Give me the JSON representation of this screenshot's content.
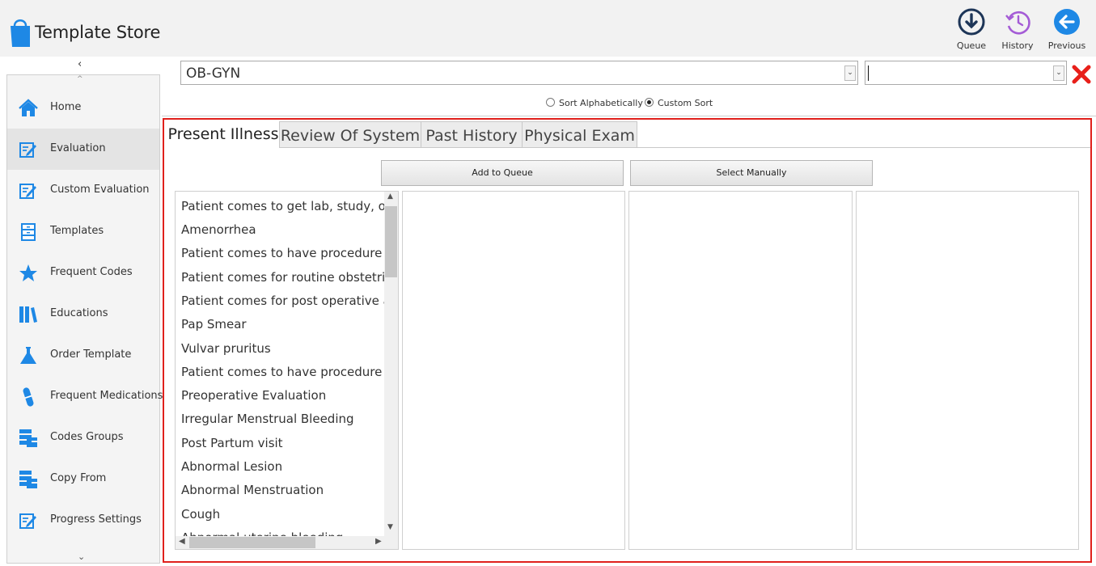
{
  "app": {
    "title": "Template Store"
  },
  "header": {
    "actions": [
      {
        "label": "Queue",
        "icon": "download-circle-icon"
      },
      {
        "label": "History",
        "icon": "history-icon"
      },
      {
        "label": "Previous",
        "icon": "back-arrow-icon"
      }
    ]
  },
  "sidebar": {
    "collapse_glyph": "‹",
    "scroll_up_glyph": "^",
    "scroll_down_glyph": "⌄",
    "items": [
      {
        "label": "Home",
        "icon": "home-icon"
      },
      {
        "label": "Evaluation",
        "icon": "edit-form-icon",
        "active": true
      },
      {
        "label": "Custom Evaluation",
        "icon": "edit-form-icon"
      },
      {
        "label": "Templates",
        "icon": "file-cabinet-icon"
      },
      {
        "label": "Frequent Codes",
        "icon": "star-icon"
      },
      {
        "label": "Educations",
        "icon": "books-icon"
      },
      {
        "label": "Order Template",
        "icon": "flask-icon"
      },
      {
        "label": "Frequent Medications",
        "icon": "pill-icon"
      },
      {
        "label": "Codes Groups",
        "icon": "server-list-icon"
      },
      {
        "label": "Copy From",
        "icon": "server-list-icon"
      },
      {
        "label": "Progress Settings",
        "icon": "edit-form-icon"
      }
    ]
  },
  "filters": {
    "specialty": "OB-GYN",
    "secondary": "",
    "sort_options": [
      {
        "label": "Sort Alphabetically",
        "selected": false
      },
      {
        "label": "Custom Sort",
        "selected": true
      }
    ]
  },
  "tabs": [
    {
      "label": "Present Illness",
      "active": true
    },
    {
      "label": "Review Of System",
      "active": false
    },
    {
      "label": "Past History",
      "active": false
    },
    {
      "label": "Physical Exam",
      "active": false
    }
  ],
  "buttons": {
    "add_to_queue": "Add to Queue",
    "select_manually": "Select Manually"
  },
  "present_illness_items": [
    "Patient comes to get lab, study, or procedure",
    "Amenorrhea",
    "Patient comes to have procedure done",
    "Patient comes for routine obstetrical visit",
    "Patient comes for post operative appointment",
    "Pap Smear",
    "Vulvar pruritus",
    "Patient comes to have procedure results",
    "Preoperative Evaluation",
    "Irregular Menstrual Bleeding",
    "Post Partum visit",
    "Abnormal Lesion",
    "Abnormal Menstruation",
    "Cough",
    "Abnormal uterine bleeding"
  ],
  "colors": {
    "accent": "#1e88e5",
    "panel_border": "#e0201c",
    "clear": "#e8201a",
    "history": "#a45bd6",
    "queue": "#1d3557"
  }
}
